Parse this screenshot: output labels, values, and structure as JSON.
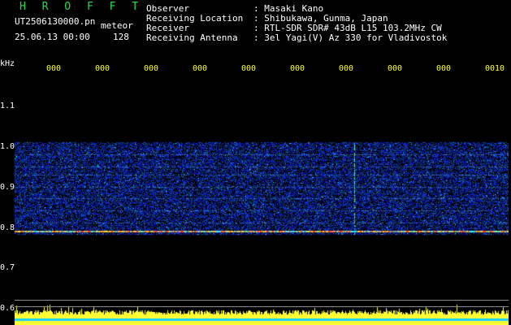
{
  "header": {
    "brand": "H R O F F T",
    "filename": "UT2506130000.pn",
    "filename_suffix": "meteor",
    "datetime": "25.06.13 00:00",
    "count": "128",
    "fields": [
      {
        "label": "Observer",
        "value": ": Masaki Kano"
      },
      {
        "label": "Receiving Location",
        "value": ": Shibukawa, Gunma, Japan"
      },
      {
        "label": "Receiver",
        "value": ": RTL-SDR SDR# 43dB L15 103.2MHz CW"
      },
      {
        "label": "Receiving Antenna",
        "value": ": 3el Yagi(V) Az 330 for Vladivostok"
      }
    ]
  },
  "axis": {
    "unit": "kHz",
    "y_ticks": [
      "1.1",
      "1.0",
      "0.9",
      "0.8",
      "0.7",
      "0.6"
    ],
    "x_ticks": [
      "000",
      "000",
      "000",
      "000",
      "000",
      "000",
      "000",
      "000",
      "000",
      "0010"
    ]
  },
  "colors": {
    "background": "#000000",
    "brand": "#19e04a",
    "text": "#ffffff",
    "tick": "#ffff33",
    "noise_low": "#0a1a8c",
    "noise_high": "#2a6bff",
    "signal_line": "#ff4020",
    "amplitude_bars": "#ffff33",
    "amplitude_base": "#18d0ff"
  },
  "spectrum": {
    "band_top_khz": 1.01,
    "band_bottom_khz": 0.78,
    "carrier_khz": 0.79,
    "reference_line_khz": 0.62
  }
}
